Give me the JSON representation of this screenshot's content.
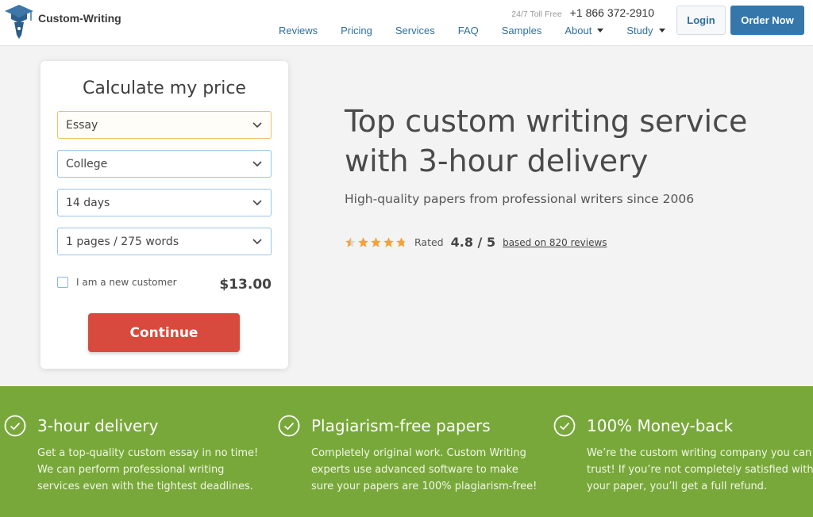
{
  "header": {
    "logo_text": "Custom-Writing",
    "toll_free": "24/7 Toll Free",
    "phone": "+1 866 372-2910",
    "nav": [
      {
        "label": "Reviews"
      },
      {
        "label": "Pricing"
      },
      {
        "label": "Services"
      },
      {
        "label": "FAQ"
      },
      {
        "label": "Samples"
      },
      {
        "label": "About"
      },
      {
        "label": "Study"
      }
    ],
    "login_label": "Login",
    "order_label": "Order Now"
  },
  "calculator": {
    "title": "Calculate my price",
    "paper_type": "Essay",
    "level": "College",
    "deadline": "14 days",
    "pages": "1 pages / 275 words",
    "new_customer_label": "I am a new customer",
    "price": "$13.00",
    "continue_label": "Continue"
  },
  "hero": {
    "title_line1": "Top custom writing service",
    "title_line2": "with 3-hour delivery",
    "subtitle": "High-quality papers from professional writers since 2006",
    "rated_label": "Rated",
    "score": "4.8 / 5",
    "reviews_link": "based on 820 reviews",
    "stars_value": 4.8
  },
  "features": [
    {
      "title": "3-hour delivery",
      "line1": "Get a top-quality custom essay in no time!",
      "line2": "We can perform professional writing",
      "line3": "services even with the tightest deadlines."
    },
    {
      "title": "Plagiarism-free papers",
      "line1": "Completely original work. Custom Writing",
      "line2": "experts use advanced software to make",
      "line3": "sure your papers are 100% plagiarism-free!"
    },
    {
      "title": "100% Money-back",
      "line1": "We’re the custom writing company you can",
      "line2": "trust! If you’re not completely satisfied with",
      "line3": "your paper, you’ll get a full refund."
    }
  ],
  "colors": {
    "brand_blue": "#3577ab",
    "cta_red": "#d84a3d",
    "band_green": "#78a83a",
    "star_orange": "#f0a33a"
  }
}
